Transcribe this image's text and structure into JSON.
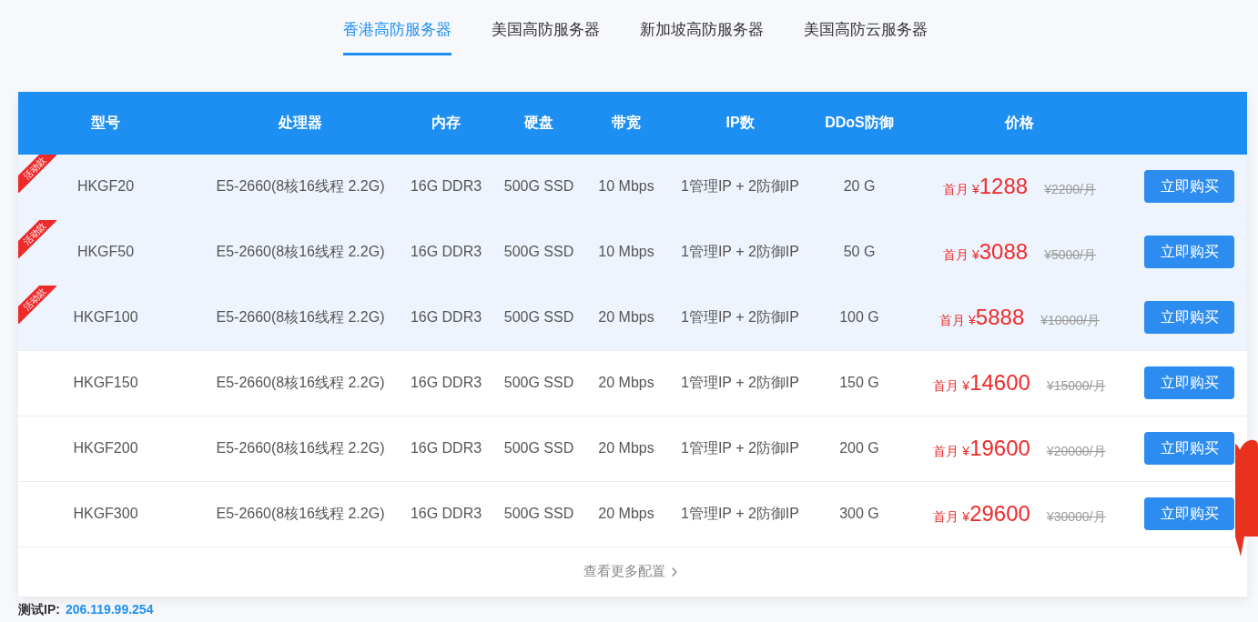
{
  "tabs": [
    {
      "label": "香港高防服务器",
      "selected": true
    },
    {
      "label": "美国高防服务器",
      "selected": false
    },
    {
      "label": "新加坡高防服务器",
      "selected": false
    },
    {
      "label": "美国高防云服务器",
      "selected": false
    }
  ],
  "table": {
    "columns": [
      "型号",
      "处理器",
      "内存",
      "硬盘",
      "带宽",
      "IP数",
      "DDoS防御",
      "价格"
    ],
    "rows": [
      {
        "promo": true,
        "ribbon": "活动款",
        "model": "HKGF20",
        "cpu": "E5-2660(8核16线程 2.2G)",
        "memory": "16G DDR3",
        "disk": "500G SSD",
        "bandwidth": "10 Mbps",
        "ips": "1管理IP + 2防御IP",
        "ddos": "20 G",
        "price_prefix": "首月 ¥",
        "price": "1288",
        "old_price": "¥2200/月",
        "button": "立即购买"
      },
      {
        "promo": true,
        "ribbon": "活动款",
        "model": "HKGF50",
        "cpu": "E5-2660(8核16线程 2.2G)",
        "memory": "16G DDR3",
        "disk": "500G SSD",
        "bandwidth": "10 Mbps",
        "ips": "1管理IP + 2防御IP",
        "ddos": "50 G",
        "price_prefix": "首月 ¥",
        "price": "3088",
        "old_price": "¥5000/月",
        "button": "立即购买"
      },
      {
        "promo": true,
        "ribbon": "活动款",
        "model": "HKGF100",
        "cpu": "E5-2660(8核16线程 2.2G)",
        "memory": "16G DDR3",
        "disk": "500G SSD",
        "bandwidth": "20 Mbps",
        "ips": "1管理IP + 2防御IP",
        "ddos": "100 G",
        "price_prefix": "首月 ¥",
        "price": "5888",
        "old_price": "¥10000/月",
        "button": "立即购买"
      },
      {
        "promo": false,
        "model": "HKGF150",
        "cpu": "E5-2660(8核16线程 2.2G)",
        "memory": "16G DDR3",
        "disk": "500G SSD",
        "bandwidth": "20 Mbps",
        "ips": "1管理IP + 2防御IP",
        "ddos": "150 G",
        "price_prefix": "首月 ¥",
        "price": "14600",
        "old_price": "¥15000/月",
        "button": "立即购买"
      },
      {
        "promo": false,
        "model": "HKGF200",
        "cpu": "E5-2660(8核16线程 2.2G)",
        "memory": "16G DDR3",
        "disk": "500G SSD",
        "bandwidth": "20 Mbps",
        "ips": "1管理IP + 2防御IP",
        "ddos": "200 G",
        "price_prefix": "首月 ¥",
        "price": "19600",
        "old_price": "¥20000/月",
        "button": "立即购买"
      },
      {
        "promo": false,
        "model": "HKGF300",
        "cpu": "E5-2660(8核16线程 2.2G)",
        "memory": "16G DDR3",
        "disk": "500G SSD",
        "bandwidth": "20 Mbps",
        "ips": "1管理IP + 2防御IP",
        "ddos": "300 G",
        "price_prefix": "首月 ¥",
        "price": "29600",
        "old_price": "¥30000/月",
        "button": "立即购买"
      }
    ],
    "more_link": "查看更多配置"
  },
  "test_ip": {
    "label": "测试IP:",
    "value": "206.119.99.254"
  }
}
